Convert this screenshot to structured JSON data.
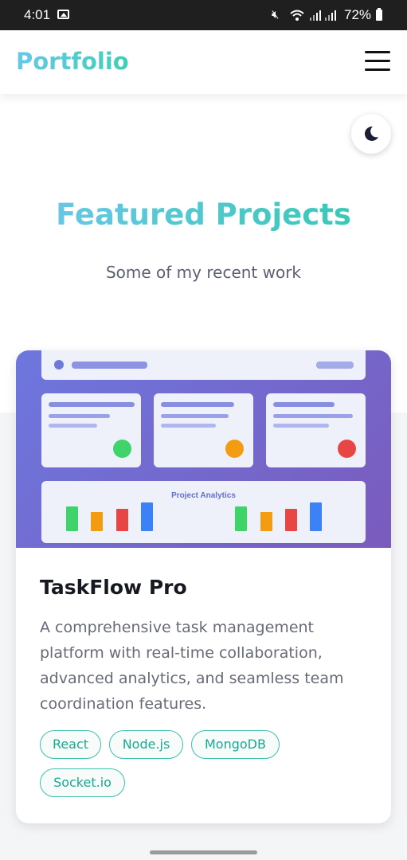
{
  "status_bar": {
    "time": "4:01",
    "battery": "72%"
  },
  "header": {
    "logo": "Portfolio"
  },
  "hero": {
    "title": "Featured Projects",
    "subtitle": "Some of my recent work"
  },
  "project": {
    "preview_caption": "Project Analytics",
    "title": "TaskFlow Pro",
    "description": "A comprehensive task management platform with real-time collaboration, advanced analytics, and seamless team coordination features.",
    "tags": [
      "React",
      "Node.js",
      "MongoDB",
      "Socket.io"
    ]
  },
  "colors": {
    "accent": "#3fcfb7",
    "preview_gradient_start": "#6d77de",
    "preview_gradient_end": "#7a5bbd"
  }
}
